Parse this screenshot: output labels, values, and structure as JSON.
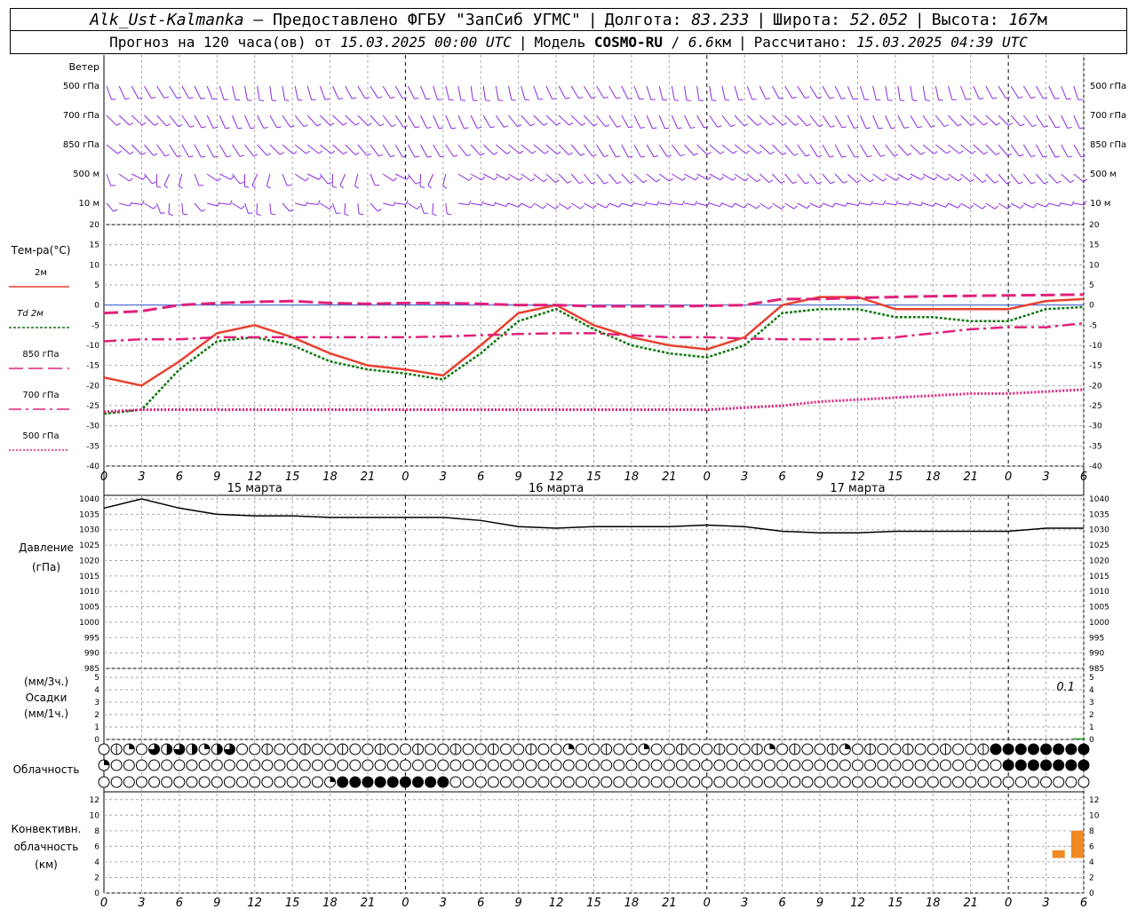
{
  "header": {
    "station": "Alk_Ust-Kalmanka",
    "provider": "— Предоставлено ФГБУ \"ЗапСиб УГМС\"",
    "lon_label": "Долгота:",
    "lon": "83.233",
    "lat_label": "Широта:",
    "lat": "52.052",
    "alt_label": "Высота:",
    "alt": "167",
    "alt_unit": "м",
    "forecast_prefix": "Прогноз на 120 часа(ов) от",
    "forecast_time": "15.03.2025 00:00 UTC",
    "model_label": "Модель",
    "model": "COSMO-RU",
    "model_res": "6.6",
    "model_res_unit": "км",
    "computed_label": "Рассчитано:",
    "computed_time": "15.03.2025 04:39 UTC"
  },
  "colors": {
    "wind": "#8a2be2",
    "t2m": "#e8412f",
    "td2m": "#117711",
    "t850": "#e0207a",
    "pressure": "#000000",
    "precip": "#22aa22",
    "convective": "#f08a24",
    "grid": "#aaaaaa"
  },
  "chart_data": [
    {
      "type": "wind_barbs",
      "title": "Ветер",
      "levels": [
        "500 гПа",
        "700 гПа",
        "850 гПа",
        "500 м",
        "10 м"
      ]
    },
    {
      "type": "line",
      "ylabel": "Тем-ра(°C)",
      "ylim": [
        -40,
        20
      ],
      "yticks": [
        20,
        15,
        10,
        5,
        0,
        -5,
        -10,
        -15,
        -20,
        -25,
        -30,
        -35,
        -40
      ],
      "x_hours": [
        0,
        3,
        6,
        9,
        12,
        15,
        18,
        21,
        24,
        27,
        30,
        33,
        36,
        39,
        42,
        45,
        48,
        51,
        54,
        57,
        60,
        63,
        66,
        69,
        72,
        75,
        78
      ],
      "series": [
        {
          "name": "2м",
          "values": [
            -18,
            -20,
            -14,
            -7,
            -5,
            -8,
            -12,
            -15,
            -16,
            -17.5,
            -10,
            -2,
            0,
            -5,
            -8,
            -10,
            -11,
            -8,
            0,
            2,
            2,
            -1,
            -1,
            -1,
            -1,
            1,
            1.5
          ]
        },
        {
          "name": "Td 2м",
          "values": [
            -27,
            -26,
            -16,
            -9,
            -8,
            -10,
            -14,
            -16,
            -17,
            -18.5,
            -12,
            -4,
            -1,
            -6,
            -10,
            -12,
            -13,
            -10,
            -2,
            -1,
            -1,
            -3,
            -3,
            -4,
            -4,
            -1,
            -0.5
          ]
        },
        {
          "name": "850 гПа",
          "values": [
            -2,
            -1.5,
            0,
            0.5,
            0.8,
            1,
            0.5,
            0.3,
            0.5,
            0.5,
            0.3,
            0,
            0,
            -0.3,
            -0.3,
            -0.3,
            -0.2,
            0,
            1.5,
            1.5,
            1.8,
            2,
            2.2,
            2.3,
            2.4,
            2.5,
            2.6
          ]
        },
        {
          "name": "700 гПа",
          "values": [
            -9,
            -8.5,
            -8.5,
            -8,
            -8,
            -8,
            -8,
            -8,
            -8,
            -7.8,
            -7.5,
            -7.2,
            -7,
            -7,
            -7.5,
            -8,
            -8,
            -8.3,
            -8.5,
            -8.5,
            -8.5,
            -8,
            -7,
            -6,
            -5.5,
            -5.5,
            -4.5
          ]
        },
        {
          "name": "500 гПа",
          "values": [
            -26.5,
            -26,
            -26,
            -26,
            -26,
            -26,
            -26,
            -26,
            -26,
            -26,
            -26,
            -26,
            -26,
            -26,
            -26,
            -26,
            -26,
            -25.5,
            -25,
            -24,
            -23.5,
            -23,
            -22.5,
            -22,
            -22,
            -21.5,
            -21
          ]
        }
      ],
      "x_ticks": [
        "0",
        "3",
        "6",
        "9",
        "12",
        "15",
        "18",
        "21",
        "0",
        "3",
        "6",
        "9",
        "12",
        "15",
        "18",
        "21",
        "0",
        "3",
        "6",
        "9",
        "12",
        "15",
        "18",
        "21",
        "0",
        "3",
        "6"
      ],
      "dates": [
        "15 марта",
        "16 марта",
        "17 марта"
      ]
    },
    {
      "type": "line",
      "ylabel": "Давление",
      "yunit": "(гПа)",
      "ylim": [
        985,
        1040
      ],
      "yticks": [
        1040,
        1035,
        1030,
        1025,
        1020,
        1015,
        1010,
        1005,
        1000,
        995,
        990,
        985
      ],
      "x_hours": [
        0,
        3,
        6,
        9,
        12,
        15,
        18,
        21,
        24,
        27,
        30,
        33,
        36,
        39,
        42,
        45,
        48,
        51,
        54,
        57,
        60,
        63,
        66,
        69,
        72,
        75,
        78
      ],
      "series": [
        {
          "name": "Давление",
          "values": [
            1037,
            1040,
            1037,
            1035,
            1034.5,
            1034.5,
            1034,
            1034,
            1034,
            1034,
            1033,
            1031,
            1030.5,
            1031,
            1031,
            1031,
            1031.5,
            1031,
            1029.5,
            1029,
            1029,
            1029.5,
            1029.5,
            1029.5,
            1029.5,
            1030.5,
            1030.5
          ]
        }
      ]
    },
    {
      "type": "bar",
      "ylabel": "Осадки",
      "ylabel_top": "(мм/3ч.)",
      "ylabel_bottom": "(мм/1ч.)",
      "ylim": [
        0,
        5
      ],
      "yticks": [
        5,
        4,
        3,
        2,
        1,
        0
      ],
      "total_label": "0.1",
      "bars": [
        {
          "hour": 78,
          "value": 0.1
        }
      ]
    },
    {
      "type": "cloud_cover",
      "ylabel": "Облачность",
      "layers": [
        "upper",
        "middle",
        "lower"
      ]
    },
    {
      "type": "bar",
      "ylabel": "Конвективн.",
      "ylabel2": "облачность",
      "yunit": "(км)",
      "ylim": [
        0,
        13
      ],
      "yticks": [
        12,
        10,
        8,
        6,
        4,
        2,
        0
      ],
      "bars": [
        {
          "hour": 76,
          "bottom": 4.5,
          "top": 5.5
        },
        {
          "hour": 77.5,
          "bottom": 4.5,
          "top": 8
        }
      ]
    }
  ]
}
